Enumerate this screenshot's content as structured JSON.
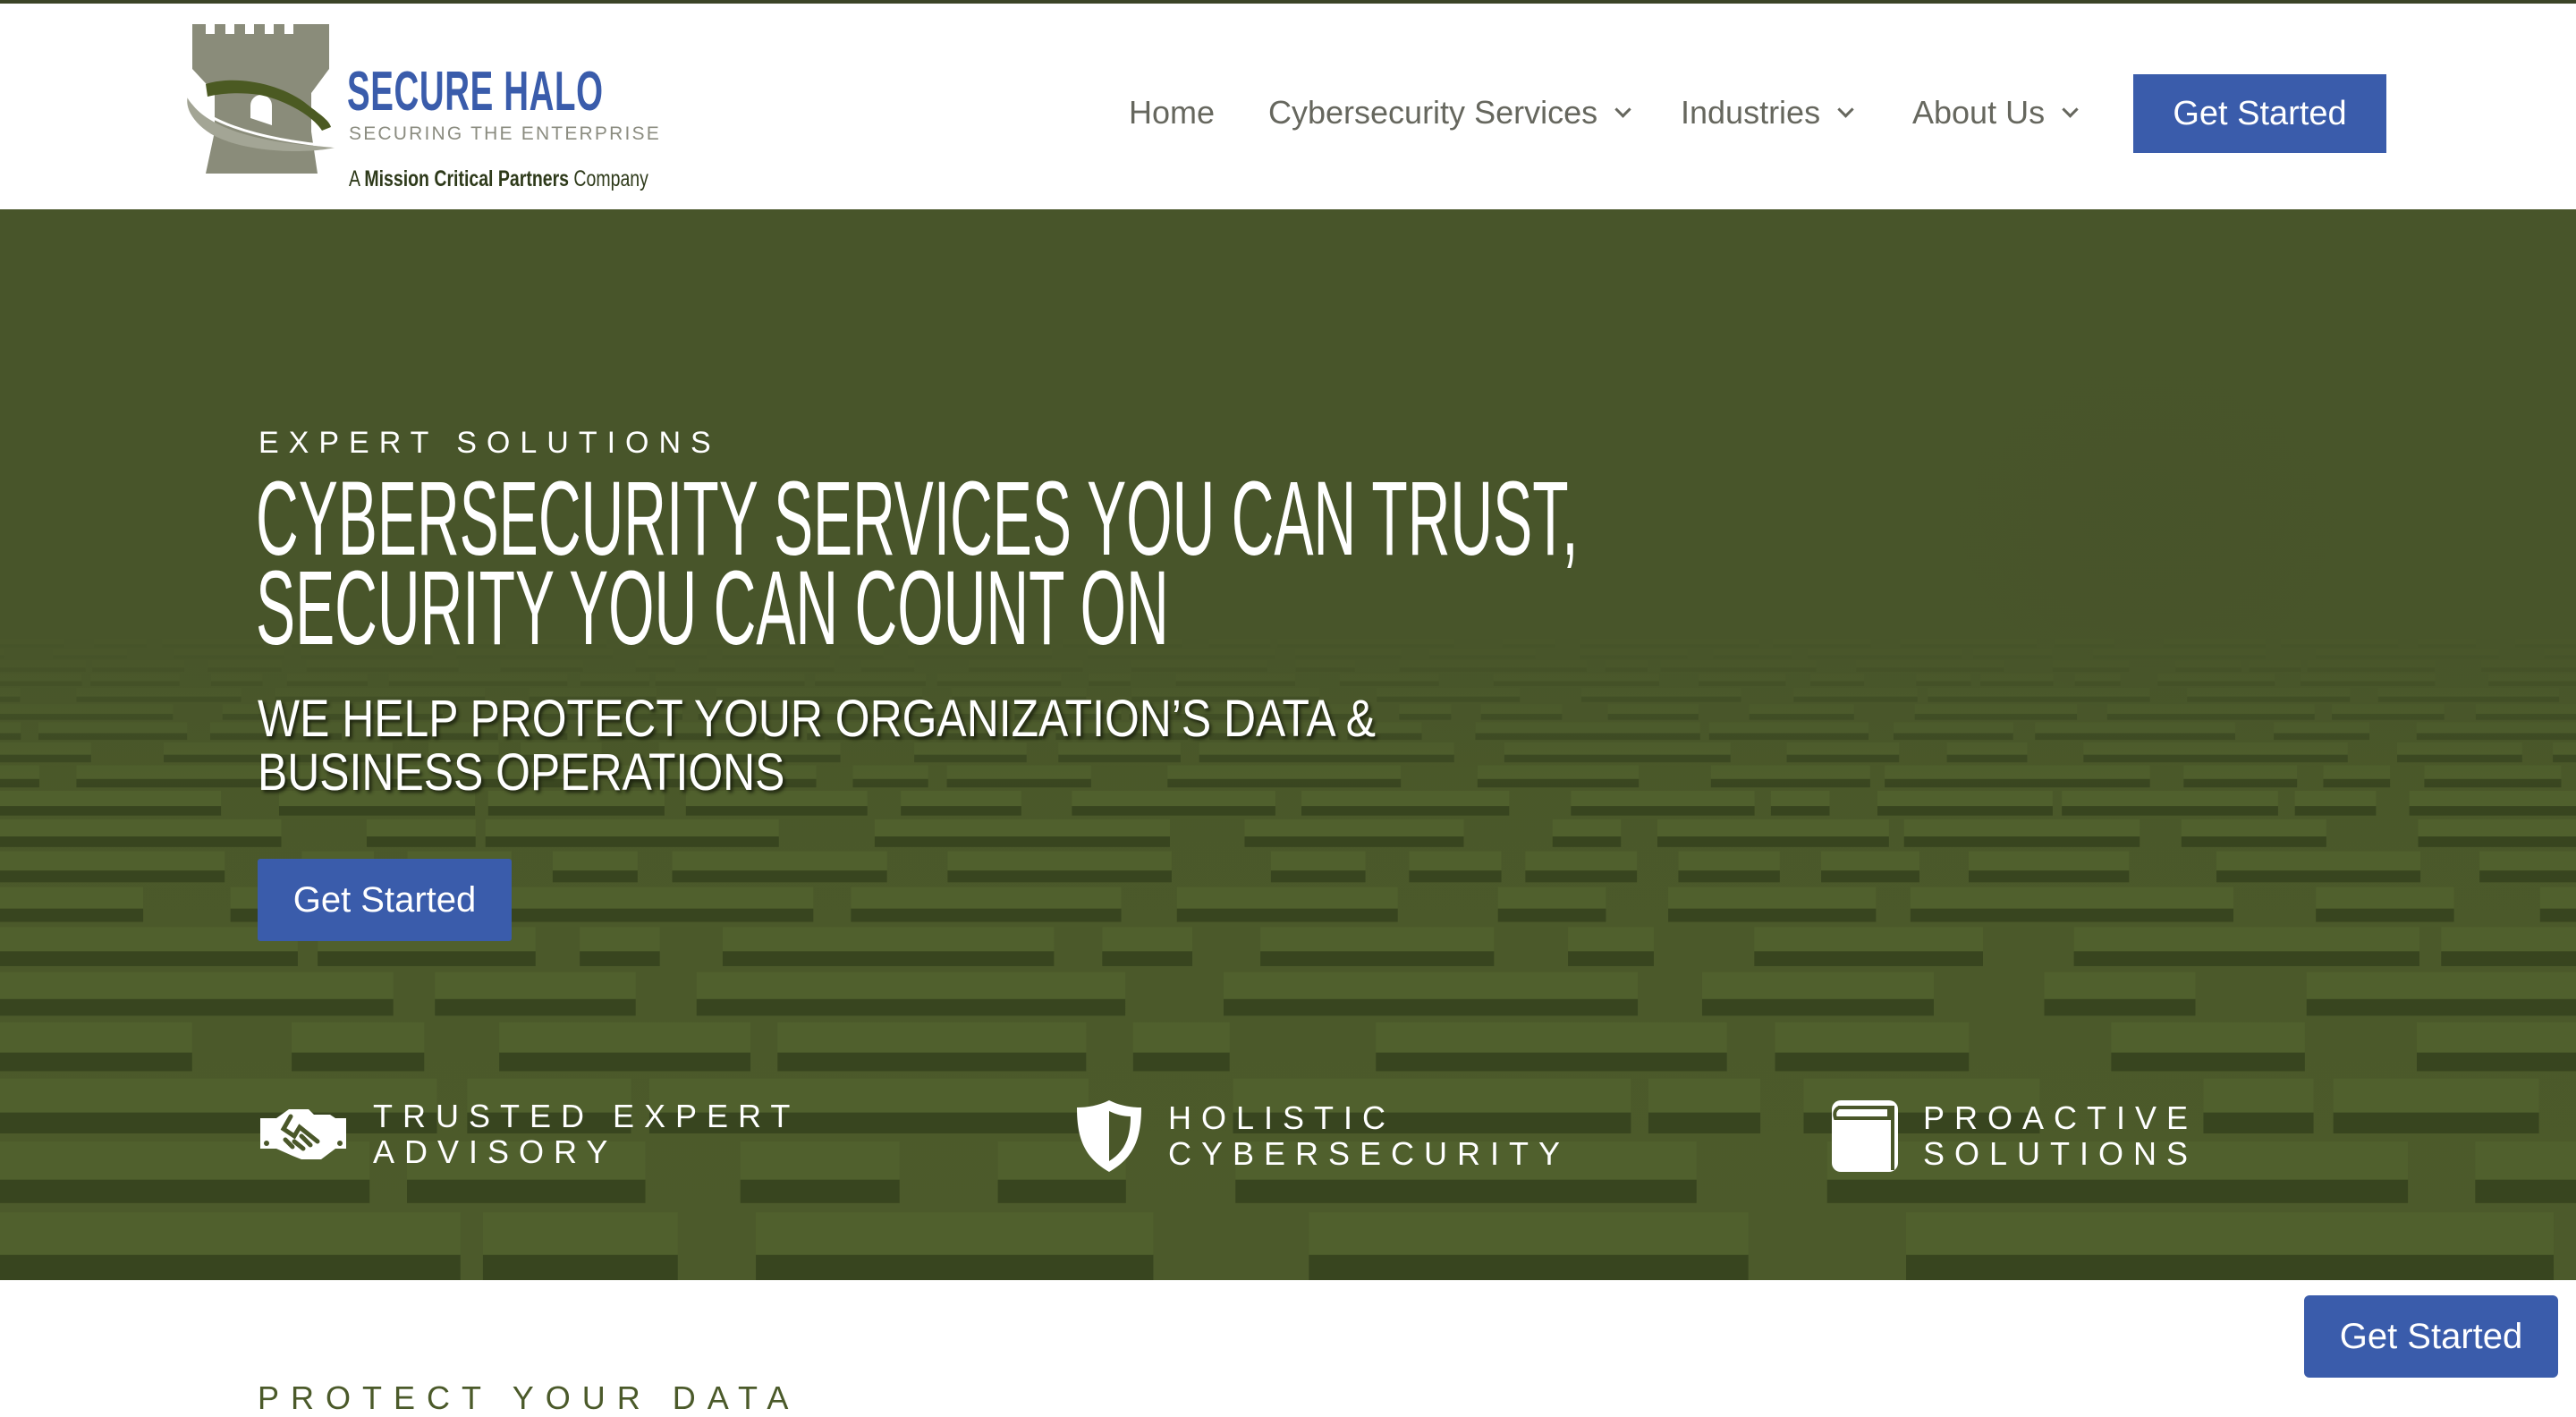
{
  "brand": {
    "name": "SECURE HALO",
    "tagline": "SECURING THE ENTERPRISE",
    "parent_prefix": "A ",
    "parent_bold": "Mission Critical Partners",
    "parent_suffix": " Company",
    "colors": {
      "blue": "#3a5cab",
      "olive": "#4b5a22",
      "tower_gray": "#8a8c7a"
    }
  },
  "nav": {
    "items": [
      {
        "label": "Home",
        "has_dropdown": false
      },
      {
        "label": "Cybersecurity Services",
        "has_dropdown": true
      },
      {
        "label": "Industries",
        "has_dropdown": true
      },
      {
        "label": "About Us",
        "has_dropdown": true
      }
    ],
    "cta_label": "Get Started"
  },
  "hero": {
    "eyebrow": "EXPERT SOLUTIONS",
    "headline_line1": "CYBERSECURITY SERVICES YOU CAN TRUST,",
    "headline_line2": "SECURITY YOU CAN COUNT ON",
    "subhead_line1": "WE HELP PROTECT YOUR ORGANIZATION’S DATA &",
    "subhead_line2": "BUSINESS OPERATIONS",
    "cta_label": "Get Started",
    "features": [
      {
        "icon": "handshake-icon",
        "line1": "TRUSTED EXPERT",
        "line2": "ADVISORY"
      },
      {
        "icon": "shield-icon",
        "line1": "HOLISTIC",
        "line2": "CYBERSECURITY"
      },
      {
        "icon": "book-icon",
        "line1": "PROACTIVE",
        "line2": "SOLUTIONS"
      }
    ]
  },
  "next_section": {
    "eyebrow": "PROTECT YOUR DATA"
  },
  "floating_cta": {
    "label": "Get Started"
  }
}
